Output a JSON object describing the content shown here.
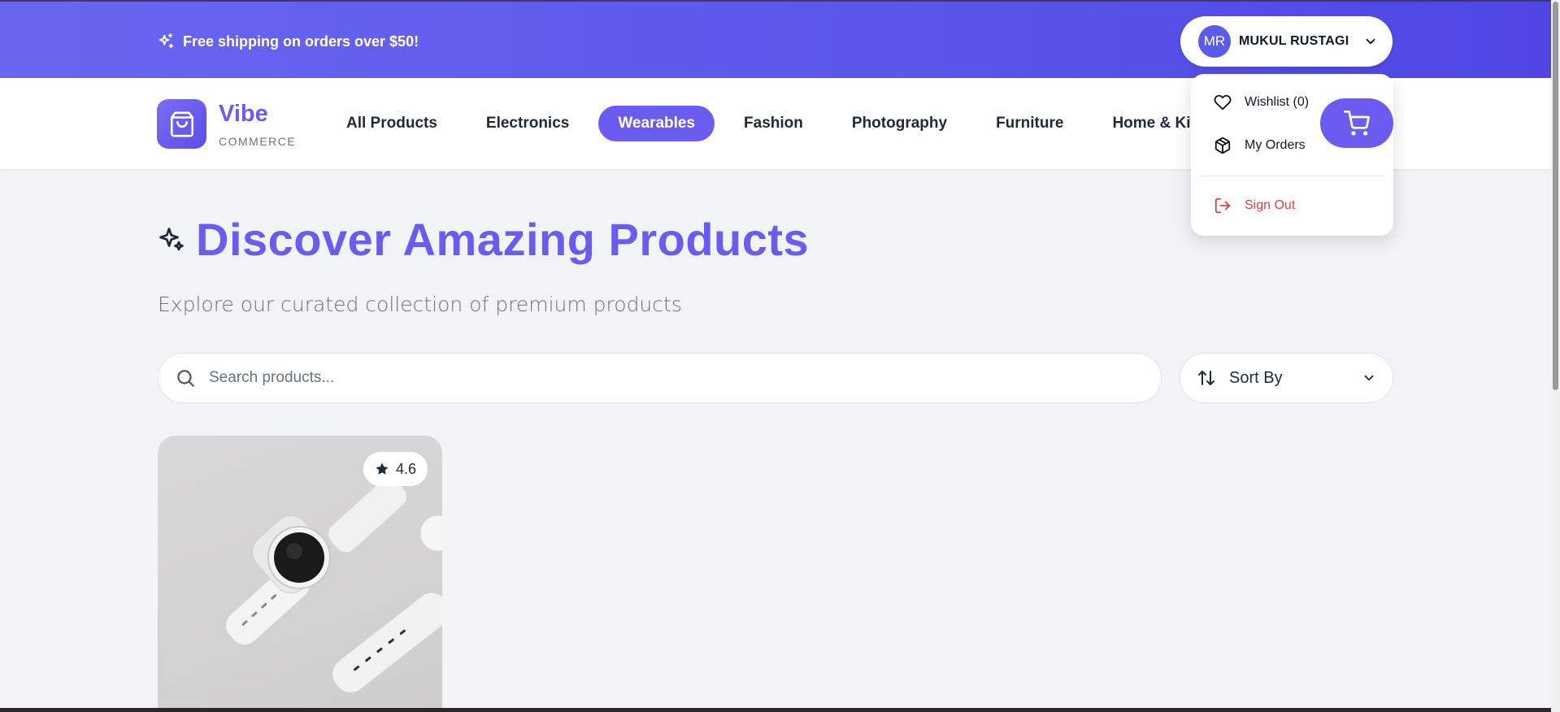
{
  "promo": {
    "text": "Free shipping on orders over $50!",
    "icon": "sparkles-icon"
  },
  "user": {
    "initials": "MR",
    "name": "MUKUL RUSTAGI"
  },
  "brand": {
    "name": "Vibe",
    "sub": "COMMERCE",
    "color": "#6a5cf0"
  },
  "nav": {
    "items": [
      {
        "label": "All Products",
        "active": false
      },
      {
        "label": "Electronics",
        "active": false
      },
      {
        "label": "Wearables",
        "active": true
      },
      {
        "label": "Fashion",
        "active": false
      },
      {
        "label": "Photography",
        "active": false
      },
      {
        "label": "Furniture",
        "active": false
      },
      {
        "label": "Home & Kitc",
        "active": false
      }
    ]
  },
  "dropdown": {
    "wishlist": "Wishlist (0)",
    "orders": "My Orders",
    "signout": "Sign Out"
  },
  "hero": {
    "title": "Discover Amazing Products",
    "subtitle": "Explore our curated collection of premium products"
  },
  "search": {
    "placeholder": "Search products..."
  },
  "sort": {
    "label": "Sort By"
  },
  "products": [
    {
      "rating": "4.6"
    }
  ],
  "colors": {
    "accent": "#6a5cf0",
    "danger": "#e53e3e",
    "topbar": "#5b55ea"
  }
}
